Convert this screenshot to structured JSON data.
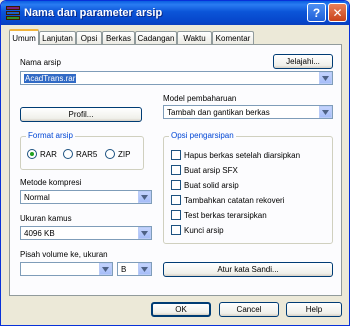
{
  "window": {
    "title": "Nama dan parameter arsip",
    "help_glyph": "?",
    "close_glyph": "✕"
  },
  "tabs": [
    {
      "label": "Umum",
      "active": true
    },
    {
      "label": "Lanjutan",
      "active": false
    },
    {
      "label": "Opsi",
      "active": false
    },
    {
      "label": "Berkas",
      "active": false
    },
    {
      "label": "Cadangan",
      "active": false
    },
    {
      "label": "Waktu",
      "active": false
    },
    {
      "label": "Komentar",
      "active": false
    }
  ],
  "archive": {
    "name_label": "Nama arsip",
    "browse_label": "Jelajahi...",
    "name_value": "AcadTrans.rar",
    "profile_label": "Profil...",
    "update_mode_label": "Model pembaharuan",
    "update_mode_value": "Tambah dan gantikan berkas"
  },
  "format": {
    "title": "Format arsip",
    "options": [
      {
        "label": "RAR",
        "selected": true
      },
      {
        "label": "RAR5",
        "selected": false
      },
      {
        "label": "ZIP",
        "selected": false
      }
    ]
  },
  "compression": {
    "label": "Metode kompresi",
    "value": "Normal"
  },
  "dictionary": {
    "label": "Ukuran kamus",
    "value": "4096 KB"
  },
  "volume": {
    "label": "Pisah volume ke, ukuran",
    "size_value": "",
    "unit_value": "B"
  },
  "archiving_options": {
    "title": "Opsi pengarsipan",
    "items": [
      {
        "label": "Hapus berkas setelah diarsipkan",
        "checked": false
      },
      {
        "label": "Buat arsip SFX",
        "checked": false
      },
      {
        "label": "Buat solid arsip",
        "checked": false
      },
      {
        "label": "Tambahkan catatan rekoveri",
        "checked": false
      },
      {
        "label": "Test berkas terarsipkan",
        "checked": false
      },
      {
        "label": "Kunci arsip",
        "checked": false
      }
    ]
  },
  "password_button": "Atur kata Sandi...",
  "footer": {
    "ok": "OK",
    "cancel": "Cancel",
    "help": "Help"
  }
}
